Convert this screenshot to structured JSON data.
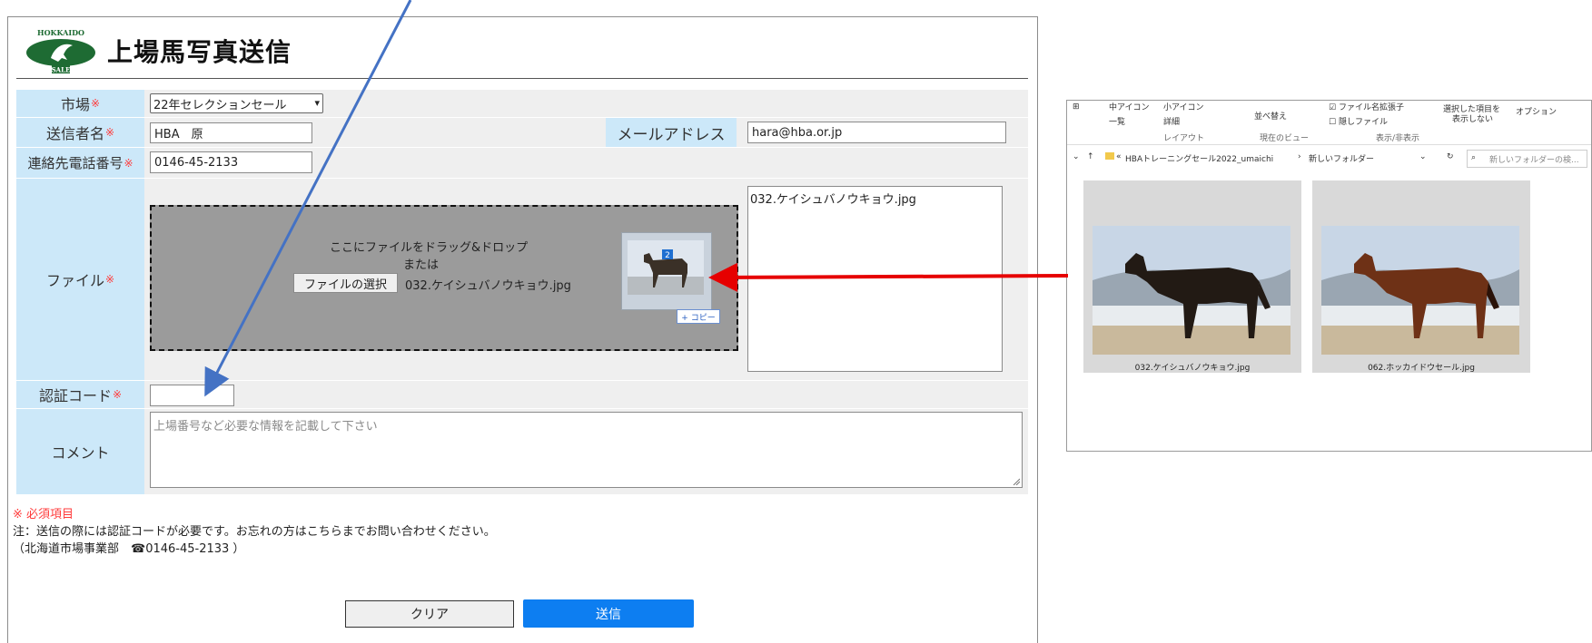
{
  "header": {
    "title": "上場馬写真送信",
    "logo_text_top": "HOKKAIDO",
    "logo_text_bottom": "SALE"
  },
  "form": {
    "required_mark": "※",
    "market": {
      "label": "市場",
      "selected": "22年セレクションセール"
    },
    "sender": {
      "label": "送信者名",
      "value": "HBA　原"
    },
    "email": {
      "label": "メールアドレス",
      "value": "hara@hba.or.jp"
    },
    "phone": {
      "label": "連絡先電話番号",
      "value": "0146-45-2133"
    },
    "file": {
      "label": "ファイル",
      "drop_text": "ここにファイルをドラッグ&ドロップ",
      "or_text": "または",
      "choose_button": "ファイルの選択",
      "chosen_file": "032.ケイシュバノウキョウ.jpg",
      "drag_count": "2",
      "copy_badge": "+ コピー",
      "file_list": "032.ケイシュバノウキョウ.jpg"
    },
    "auth_code": {
      "label": "認証コード",
      "value": ""
    },
    "comment": {
      "label": "コメント",
      "placeholder": "上場番号など必要な情報を記載して下さい"
    }
  },
  "notes": {
    "required_legend": "※ 必須項目",
    "note_line": "注：送信の際には認証コードが必要です。お忘れの方はこちらまでお問い合わせください。",
    "contact_line": "（北海道市場事業部　☎0146-45-2133 ）"
  },
  "buttons": {
    "clear": "クリア",
    "send": "送信"
  },
  "explorer": {
    "ribbon": {
      "view_large": "中アイコン",
      "view_small": "小アイコン",
      "view_list": "一覧",
      "view_detail": "詳細",
      "sort_label": "並べ替え",
      "ext_label": "ファイル名拡張子",
      "hidden_label": "隠しファイル",
      "hide_selected": "選択した項目を",
      "hide_selected2": "表示しない",
      "options": "オプション",
      "group_layout": "レイアウト",
      "group_current": "現在のビュー",
      "group_show": "表示/非表示"
    },
    "path_root": "HBAトレーニングセール2022_umaichi",
    "path_sep": "›",
    "path_current": "新しいフォルダー",
    "search_placeholder": "新しいフォルダーの検...",
    "files": [
      {
        "name": "032.ケイシュバノウキョウ.jpg"
      },
      {
        "name": "062.ホッカイドウセール.jpg"
      }
    ]
  },
  "colors": {
    "label_bg": "#cce8f9",
    "required": "#ff3b3b",
    "send_button": "#0d7ef1",
    "drop_zone": "#9b9b9b",
    "arrow_blue": "#4472c4",
    "arrow_red": "#e60000"
  }
}
